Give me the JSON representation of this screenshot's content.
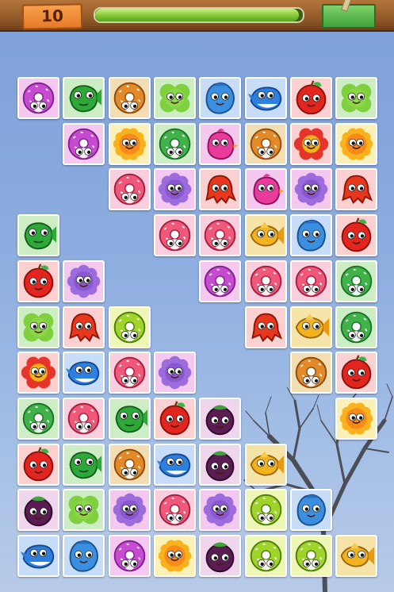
{
  "header": {
    "level": "10",
    "timer_remaining": 0.98,
    "menu_icon": "green-menu-button"
  },
  "board": {
    "rows": [
      [
        "donut-purple",
        "fish-green",
        "donut-orange",
        "clover-green",
        "drop-blue",
        "whale-blue",
        "apple-red",
        "clover-green"
      ],
      [
        null,
        "donut-purple",
        "sunflower-yellow",
        "donut-green",
        "bird-pink",
        "donut-orange",
        "flower-red",
        "sunflower-yellow"
      ],
      [
        null,
        null,
        "donut-pink",
        "flower-purple",
        "octopus-red",
        "bird-pink",
        "flower-purple",
        "octopus-red"
      ],
      [
        "fish-green",
        null,
        null,
        "donut-pink",
        "donut-pink",
        "fish-gold",
        "drop-blue",
        "apple-red"
      ],
      [
        "apple-red",
        "flower-purple",
        null,
        null,
        "donut-purple",
        "donut-pink",
        "donut-pink",
        "donut-green"
      ],
      [
        "clover-green",
        "octopus-red",
        "donut-lime",
        null,
        null,
        "octopus-red",
        "fish-gold",
        "donut-green"
      ],
      [
        "flower-red",
        "whale-blue",
        "donut-pink",
        "flower-purple",
        null,
        null,
        "donut-orange",
        "apple-red"
      ],
      [
        "donut-green",
        "donut-pink",
        "fish-green",
        "apple-red",
        "mangosteen-purple",
        null,
        null,
        "sunflower-yellow"
      ],
      [
        "apple-red",
        "fish-green",
        "donut-orange",
        "whale-blue",
        "mangosteen-purple",
        "fish-gold",
        null,
        null
      ],
      [
        "mangosteen-purple",
        "clover-green",
        "flower-purple",
        "donut-pink",
        "flower-purple",
        "donut-lime",
        "drop-blue",
        null
      ],
      [
        "whale-blue",
        "drop-blue",
        "donut-purple",
        "sunflower-yellow",
        "mangosteen-purple",
        "donut-lime",
        "donut-lime",
        "fish-gold"
      ]
    ],
    "tile_colors": {
      "purple": "#f5c8ef",
      "pink": "#f9cfe0",
      "green": "#cdeec4",
      "orange": "#f3ddb3",
      "blue": "#c7dcf6",
      "red": "#fad0d0",
      "yellow": "#fbf1b8",
      "lime": "#eef7b6",
      "gold": "#f6e3a8",
      "mangosteen": "#f0d6ec"
    }
  }
}
